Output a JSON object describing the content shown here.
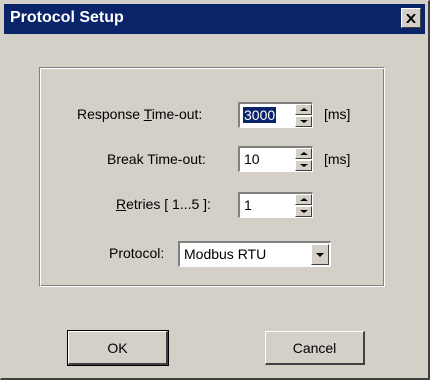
{
  "window": {
    "title": "Protocol Setup",
    "close_icon": "close-icon"
  },
  "fields": {
    "response_timeout": {
      "label_pre": "Response ",
      "label_accel": "T",
      "label_post": "ime-out:",
      "value": "3000",
      "unit": "[ms]"
    },
    "break_timeout": {
      "label": "Break Time-out:",
      "value": "10",
      "unit": "[ms]"
    },
    "retries": {
      "label_accel": "R",
      "label_post": "etries [ 1...5 ]:",
      "value": "1"
    },
    "protocol": {
      "label": "Protocol:",
      "value": "Modbus RTU"
    }
  },
  "buttons": {
    "ok": "OK",
    "cancel": "Cancel"
  }
}
